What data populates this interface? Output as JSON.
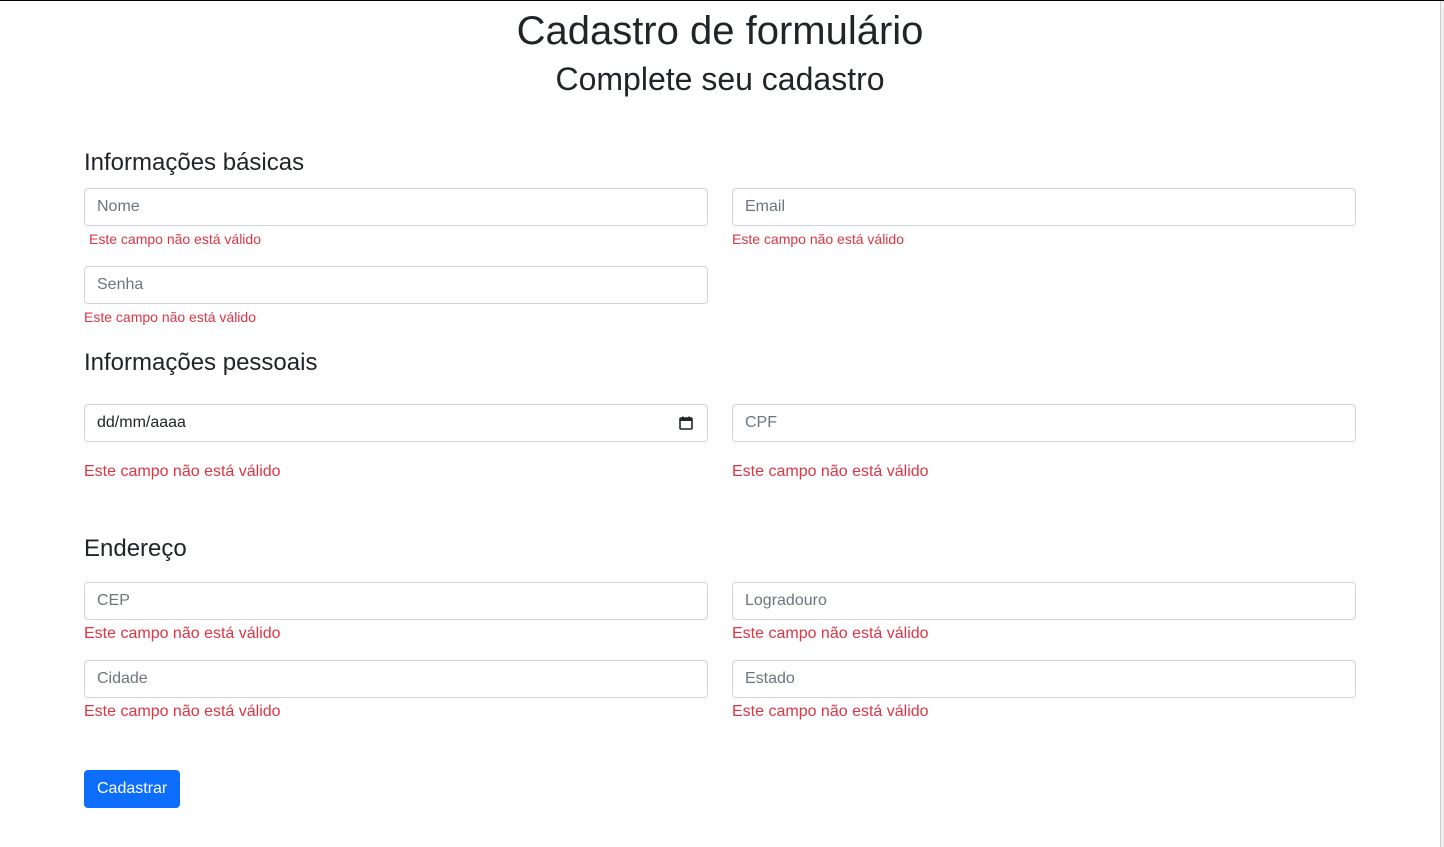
{
  "header": {
    "title": "Cadastro de formulário",
    "subtitle": "Complete seu cadastro"
  },
  "sections": {
    "basic": {
      "title": "Informações básicas",
      "nome_placeholder": "Nome",
      "email_placeholder": "Email",
      "senha_placeholder": "Senha"
    },
    "personal": {
      "title": "Informações pessoais",
      "date_value": "dd/mm/aaaa",
      "cpf_placeholder": "CPF"
    },
    "address": {
      "title": "Endereço",
      "cep_placeholder": "CEP",
      "logradouro_placeholder": "Logradouro",
      "cidade_placeholder": "Cidade",
      "estado_placeholder": "Estado"
    }
  },
  "validation": {
    "error_message": "Este campo não está válido"
  },
  "actions": {
    "submit_label": "Cadastrar"
  },
  "icons": {
    "date_picker": "calendar-icon"
  },
  "colors": {
    "primary": "#0d6efd",
    "error": "#dc3545",
    "border": "#ced4da",
    "text": "#212529",
    "placeholder": "#6c757d"
  }
}
